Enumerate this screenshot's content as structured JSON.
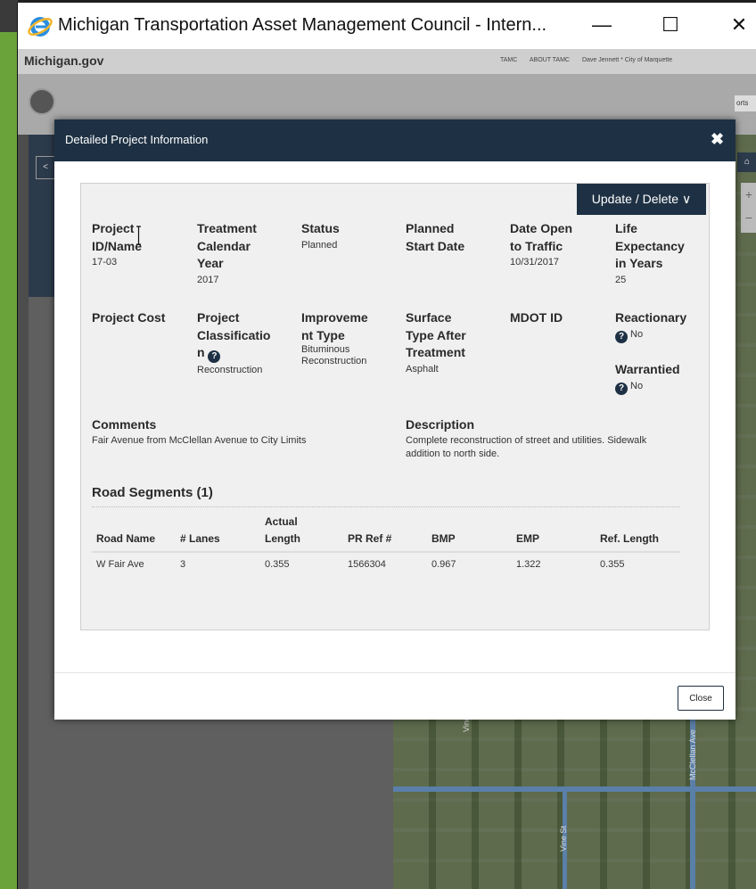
{
  "window": {
    "title": "Michigan Transportation Asset Management Council - Intern...",
    "minimize": "—",
    "maximize": "☐",
    "close": "✕"
  },
  "background": {
    "mi_logo": "Michigan.gov",
    "links": [
      "TAMC",
      "ABOUT TAMC",
      "Dave Jennett * City of Marquette"
    ],
    "ports_tab": "orts",
    "back": "<",
    "home": "⌂",
    "zoom_in": "+",
    "zoom_out": "−",
    "road_labels": [
      "McClellan Ave",
      "Vine St",
      "Vine St"
    ]
  },
  "modal": {
    "title": "Detailed Project Information",
    "close_x": "✖",
    "update_button": "Update / Delete",
    "fields": [
      {
        "label": "Project ID/Name",
        "value": "17-03"
      },
      {
        "label": "Treatment Calendar Year",
        "value": "2017"
      },
      {
        "label": "Status",
        "value": "Planned"
      },
      {
        "label": "Planned Start Date",
        "value": ""
      },
      {
        "label": "Date Open to Traffic",
        "value": "10/31/2017"
      },
      {
        "label": "Life Expectancy in Years",
        "value": "25"
      },
      {
        "label": "Project Cost",
        "value": ""
      },
      {
        "label": "Project Classification",
        "value": "Reconstruction"
      },
      {
        "label": "Improvement Type",
        "value": "Bituminous Reconstruction"
      },
      {
        "label": "Surface Type After Treatment",
        "value": "Asphalt"
      },
      {
        "label": "MDOT ID",
        "value": ""
      },
      {
        "label": "Reactionary",
        "value": "No"
      },
      {
        "label": "Warrantied",
        "value": "No"
      },
      {
        "label": "Comments",
        "value": "Fair Avenue from McClellan Avenue to City Limits"
      },
      {
        "label": "Description",
        "value": "Complete reconstruction of street and utilities. Sidewalk addition to north side."
      }
    ],
    "segments_title": "Road Segments (1)",
    "segments": {
      "columns": [
        "Road Name",
        "# Lanes",
        "Actual Length",
        "PR Ref #",
        "BMP",
        "EMP",
        "Ref. Length"
      ],
      "rows": [
        [
          "W Fair Ave",
          "3",
          "0.355",
          "1566304",
          "0.967",
          "1.322",
          "0.355"
        ]
      ]
    },
    "close_button": "Close"
  }
}
